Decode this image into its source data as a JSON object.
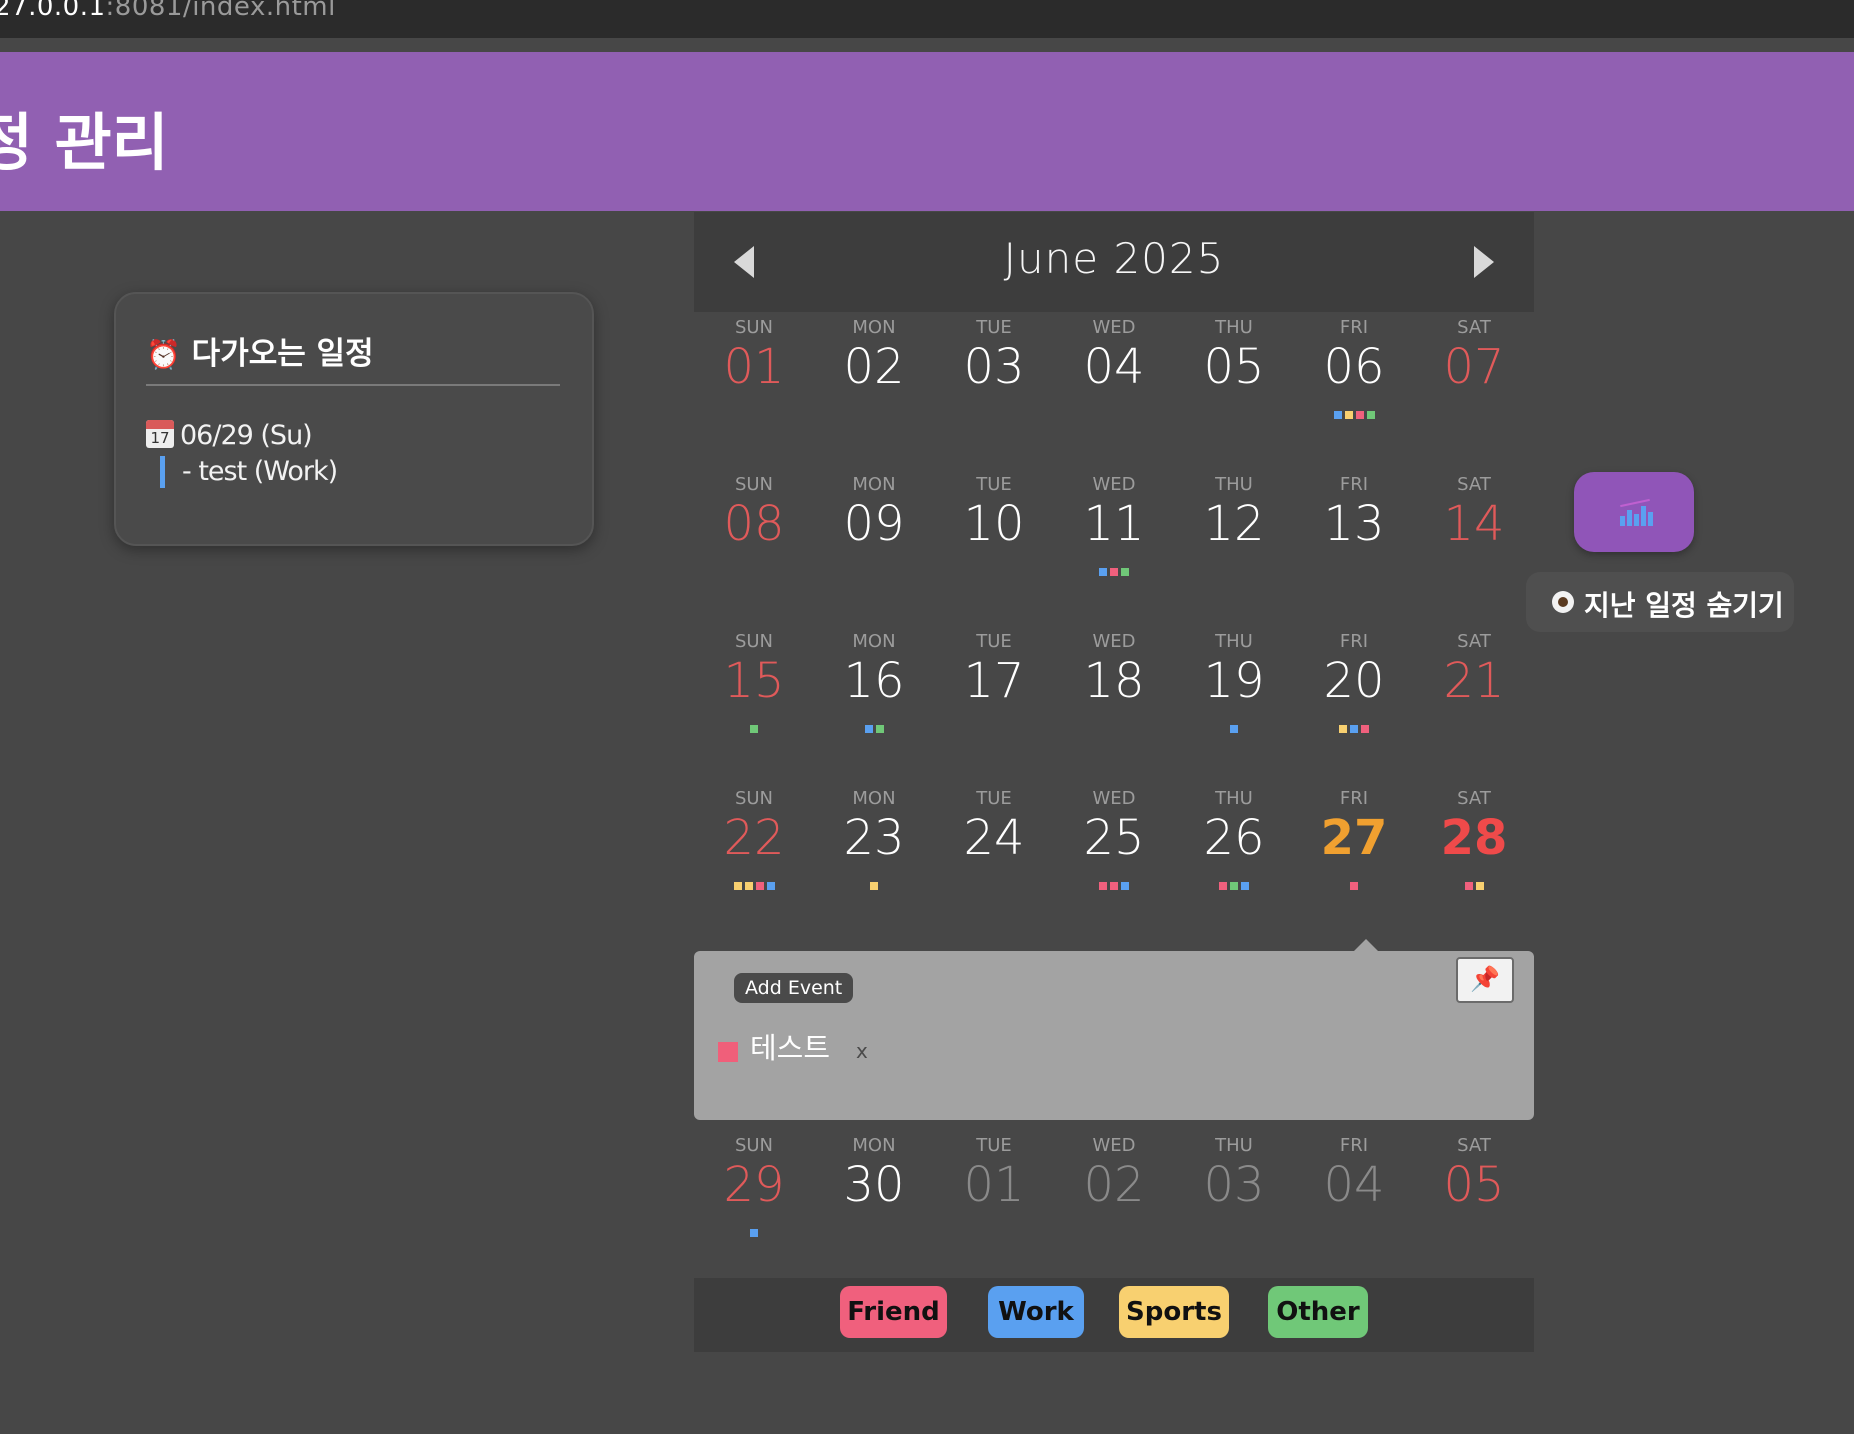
{
  "browser": {
    "url_host": "27.0.0.1",
    "url_path": ":8081/index.html"
  },
  "header": {
    "title": "정 관리"
  },
  "upcoming": {
    "icon": "alarm-clock-icon",
    "title": "다가오는 일정",
    "calendar_icon_num": "17",
    "date": "06/29 (Su)",
    "event": "- test (Work)"
  },
  "calendar": {
    "month_title": "June 2025",
    "weekdays": [
      "SUN",
      "MON",
      "TUE",
      "WED",
      "THU",
      "FRI",
      "SAT"
    ],
    "weeks": [
      [
        [
          "01",
          []
        ],
        [
          "02",
          []
        ],
        [
          "03",
          []
        ],
        [
          "04",
          []
        ],
        [
          "05",
          []
        ],
        [
          "06",
          [
            "work",
            "sports",
            "friend",
            "other"
          ]
        ],
        [
          "07",
          []
        ]
      ],
      [
        [
          "08",
          []
        ],
        [
          "09",
          []
        ],
        [
          "10",
          []
        ],
        [
          "11",
          [
            "work",
            "friend",
            "other"
          ]
        ],
        [
          "12",
          []
        ],
        [
          "13",
          []
        ],
        [
          "14",
          []
        ]
      ],
      [
        [
          "15",
          [
            "other"
          ]
        ],
        [
          "16",
          [
            "work",
            "other"
          ]
        ],
        [
          "17",
          []
        ],
        [
          "18",
          []
        ],
        [
          "19",
          [
            "work"
          ]
        ],
        [
          "20",
          [
            "sports",
            "work",
            "friend"
          ]
        ],
        [
          "21",
          []
        ]
      ],
      [
        [
          "22",
          [
            "sports",
            "sports",
            "friend",
            "work"
          ]
        ],
        [
          "23",
          [
            "sports"
          ]
        ],
        [
          "24",
          []
        ],
        [
          "25",
          [
            "friend",
            "friend",
            "work"
          ]
        ],
        [
          "26",
          [
            "friend",
            "other",
            "work"
          ]
        ],
        [
          "27",
          [
            "friend"
          ]
        ],
        [
          "28",
          [
            "friend",
            "sports"
          ]
        ]
      ],
      [
        [
          "29",
          [
            "work"
          ]
        ],
        [
          "30",
          []
        ],
        [
          "01",
          []
        ],
        [
          "02",
          []
        ],
        [
          "03",
          []
        ],
        [
          "04",
          []
        ],
        [
          "05",
          []
        ]
      ]
    ],
    "today_label": "27",
    "selected_label": "28"
  },
  "popup": {
    "add_event_label": "Add Event",
    "pin_icon": "pushpin-icon",
    "events": [
      {
        "name": "테스트",
        "color": "#f05f7a",
        "delete_label": "x"
      }
    ]
  },
  "legend": {
    "tags": [
      {
        "label": "Friend",
        "color": "#f0607d"
      },
      {
        "label": "Work",
        "color": "#5aa0f0"
      },
      {
        "label": "Sports",
        "color": "#f8d070"
      },
      {
        "label": "Other",
        "color": "#70c878"
      }
    ]
  },
  "category_colors": {
    "friend": "#f0607d",
    "work": "#5aa0f0",
    "sports": "#f8d070",
    "other": "#70c878"
  },
  "side": {
    "stats_icon": "bar-chart-icon",
    "hide_past_label": "지난 일정 숨기기",
    "hide_past_icon": "eye-icon"
  }
}
